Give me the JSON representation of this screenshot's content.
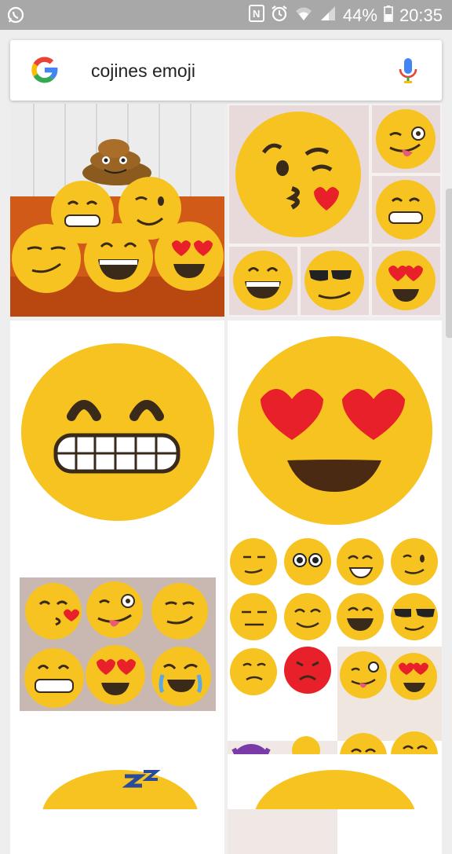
{
  "status_bar": {
    "battery": "44%",
    "time": "20:35"
  },
  "search": {
    "query": "cojines emoji"
  },
  "colors": {
    "emoji_yellow": "#f6c320",
    "heart_red": "#e8202a",
    "google_blue": "#4285f4",
    "google_red": "#ea4335",
    "google_yellow": "#fbbc05",
    "google_green": "#34a853"
  },
  "results": [
    {
      "subject": "poop-and-emoji-pillows-on-sofa"
    },
    {
      "subject": "kiss-emoji-pillow-collage"
    },
    {
      "subject": "grinning-teeth-emoji-pillow"
    },
    {
      "subject": "heart-eyes-emoji-pillow"
    },
    {
      "subject": "six-emoji-pillows"
    },
    {
      "subject": "many-emoji-pillows-collage"
    }
  ]
}
